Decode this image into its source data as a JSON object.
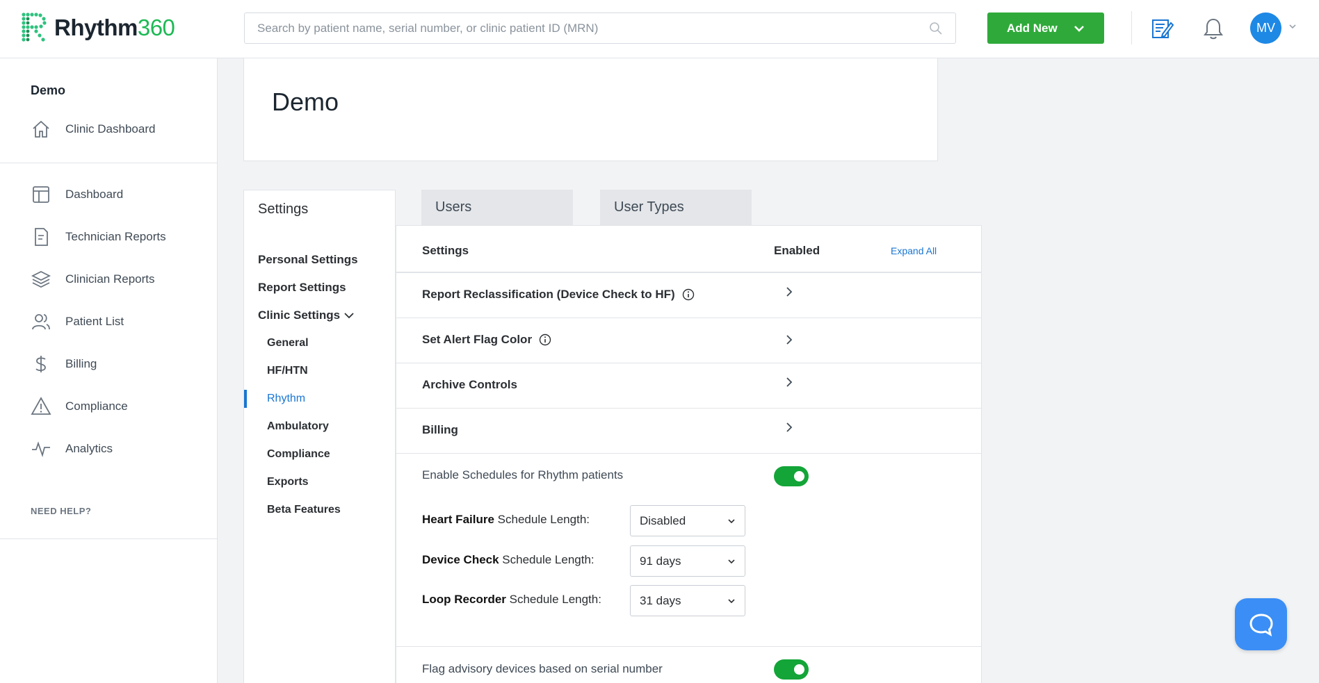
{
  "app": {
    "brand_name": "Rhythm",
    "brand_number": "360"
  },
  "header": {
    "search_placeholder": "Search by patient name, serial number, or clinic patient ID (MRN)",
    "add_new_label": "Add New",
    "user_initials": "MV"
  },
  "sidebar": {
    "clinic_name": "Demo",
    "clinic_dashboard": "Clinic Dashboard",
    "items": [
      {
        "label": "Dashboard",
        "icon": "dashboard-icon"
      },
      {
        "label": "Technician Reports",
        "icon": "report-icon"
      },
      {
        "label": "Clinician Reports",
        "icon": "layers-icon"
      },
      {
        "label": "Patient List",
        "icon": "users-icon"
      },
      {
        "label": "Billing",
        "icon": "dollar-icon"
      },
      {
        "label": "Compliance",
        "icon": "warning-icon"
      },
      {
        "label": "Analytics",
        "icon": "pulse-icon"
      }
    ],
    "help_label": "NEED HELP?"
  },
  "page": {
    "title": "Demo"
  },
  "settings_nav": {
    "title": "Settings",
    "personal": "Personal Settings",
    "report": "Report Settings",
    "clinic": "Clinic Settings",
    "sub_items": [
      "General",
      "HF/HTN",
      "Rhythm",
      "Ambulatory",
      "Compliance",
      "Exports",
      "Beta Features"
    ],
    "active_item": "Rhythm"
  },
  "tabs": {
    "users": "Users",
    "user_types": "User Types"
  },
  "panel": {
    "col_settings": "Settings",
    "col_enabled": "Enabled",
    "expand_all": "Expand All",
    "rows": [
      {
        "label": "Report Reclassification (Device Check to HF)",
        "info": true
      },
      {
        "label": "Set Alert Flag Color",
        "info": true
      },
      {
        "label": "Archive Controls",
        "info": false
      },
      {
        "label": "Billing",
        "info": false
      }
    ],
    "enable_schedules": {
      "label": "Enable Schedules for Rhythm patients",
      "enabled": true
    },
    "schedules": [
      {
        "bold": "Heart Failure",
        "rest": " Schedule Length:",
        "value": "Disabled"
      },
      {
        "bold": "Device Check",
        "rest": " Schedule Length:",
        "value": "91 days"
      },
      {
        "bold": "Loop Recorder",
        "rest": " Schedule Length:",
        "value": "31 days"
      }
    ],
    "flag_advisory": {
      "label": "Flag advisory devices based on serial number",
      "enabled": true
    }
  },
  "colors": {
    "brand_green": "#1db954",
    "button_green": "#2faa3a",
    "toggle_green": "#13a538",
    "accent_blue": "#1976d2",
    "avatar_blue": "#1e88e5",
    "chat_blue": "#3b8ef5"
  }
}
